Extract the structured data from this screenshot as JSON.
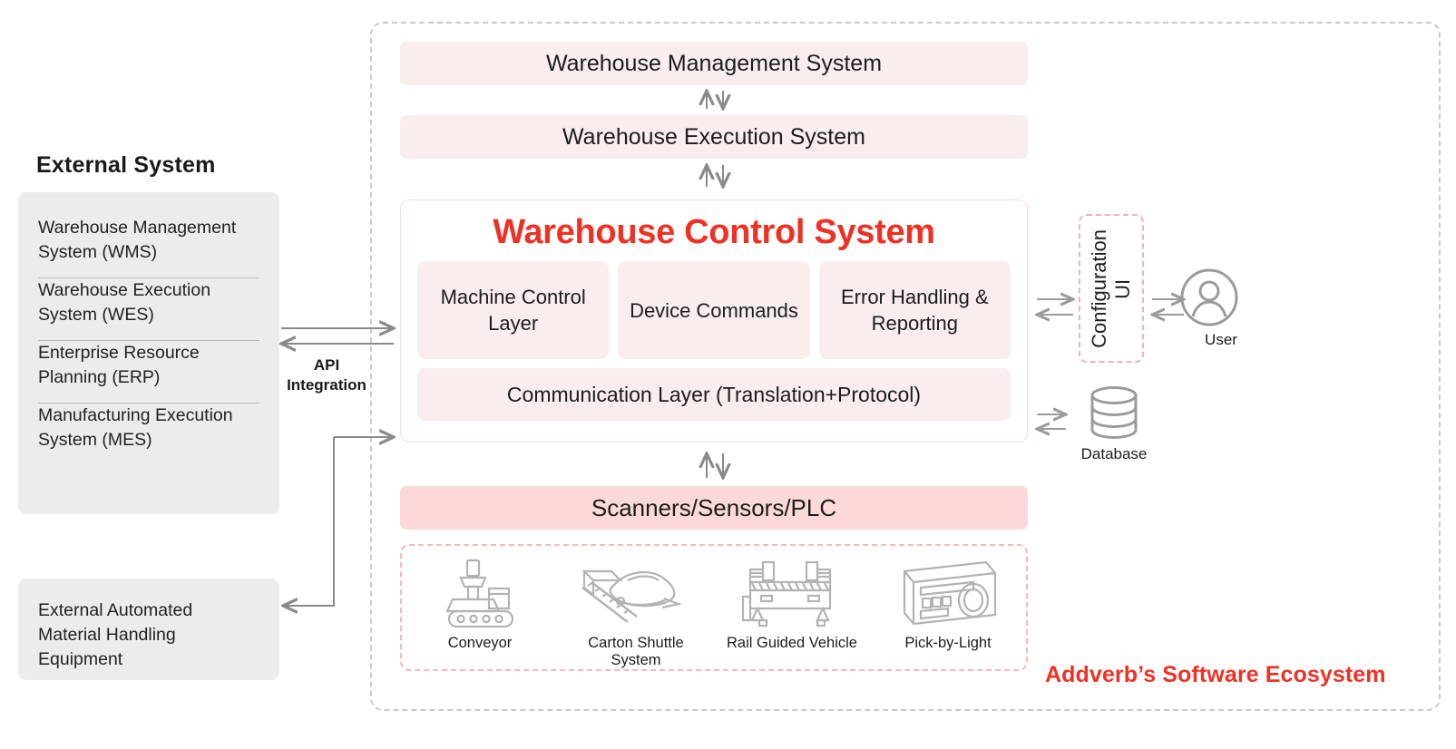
{
  "external": {
    "title": "External System",
    "items": [
      "Warehouse Management System (WMS)",
      "Warehouse Execution System (WES)",
      "Enterprise Resource Planning (ERP)",
      "Manufacturing Execution System (MES)"
    ],
    "equipment_box": "External Automated Material Handling Equipment"
  },
  "connectors": {
    "api_label": "API\nIntegration"
  },
  "ecosystem": {
    "brand": "Addverb’s Software Ecosystem"
  },
  "stack": {
    "wms": "Warehouse Management System",
    "wes": "Warehouse Execution System",
    "scanners": "Scanners/Sensors/PLC"
  },
  "wcs": {
    "title": "Warehouse Control System",
    "sub_boxes": [
      "Machine Control Layer",
      "Device Commands",
      "Error Handling & Reporting"
    ],
    "communication_layer": "Communication Layer (Translation+Protocol)"
  },
  "equipment": [
    {
      "label": "Conveyor",
      "icon": "conveyor-icon"
    },
    {
      "label": "Carton Shuttle System",
      "icon": "carton-shuttle-icon"
    },
    {
      "label": "Rail Guided Vehicle",
      "icon": "rail-guided-vehicle-icon"
    },
    {
      "label": "Pick-by-Light",
      "icon": "pick-by-light-icon"
    }
  ],
  "side": {
    "config_ui": "Configuration\nUI",
    "user": "User",
    "database": "Database"
  },
  "colors": {
    "accent_red": "#ef3124",
    "pink_light": "#f9eded",
    "pink_deep": "#fcd9d9",
    "panel_gray": "#ececec",
    "wire_gray": "#8a8a8a",
    "dash_gray": "#c9c9c9",
    "dash_pink": "#f4b0b0"
  }
}
